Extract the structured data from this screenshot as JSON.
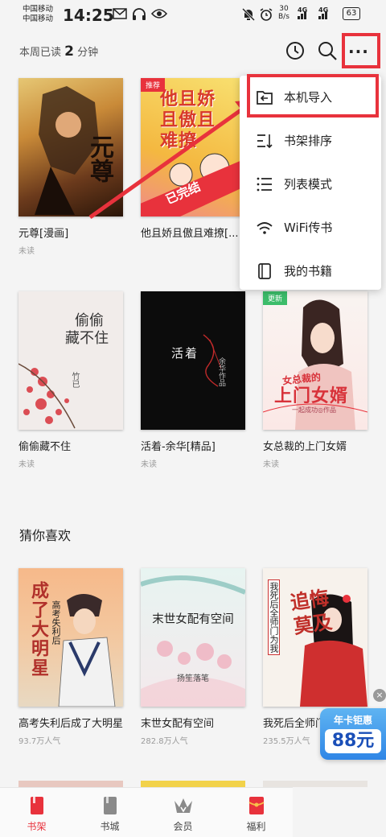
{
  "status_bar": {
    "carrier1": "中国移动",
    "carrier2": "中国移动",
    "time": "14:25",
    "speed_value": "30",
    "speed_unit": "B/s",
    "net1": "4G",
    "net2": "4G",
    "battery": "63"
  },
  "header": {
    "read_prefix": "本周已读",
    "read_value": "2",
    "read_unit": "分钟"
  },
  "menu": {
    "items": [
      {
        "label": "本机导入",
        "icon": "folder-import-icon"
      },
      {
        "label": "书架排序",
        "icon": "sort-icon"
      },
      {
        "label": "列表模式",
        "icon": "list-icon"
      },
      {
        "label": "WiFi传书",
        "icon": "wifi-icon"
      },
      {
        "label": "我的书籍",
        "icon": "book-icon"
      }
    ]
  },
  "shelf": [
    {
      "title": "元尊[漫画]",
      "status": "未读",
      "cover_text": "元尊"
    },
    {
      "title": "他且娇且傲且难撩[...",
      "status": "",
      "badge": "推荐",
      "cover_text": [
        "他且娇",
        "且傲且",
        "难撩"
      ],
      "ribbon": "已完结"
    },
    {
      "title": "偷偷藏不住",
      "status": "未读",
      "cover_text": [
        "偷偷",
        "藏不住"
      ],
      "cover_author": "竹已"
    },
    {
      "title": "活着-余华[精品]",
      "status": "未读",
      "cover_text": "活着",
      "cover_author": "余华作品"
    },
    {
      "title": "女总裁的上门女婿",
      "status": "未读",
      "badge": "更新",
      "cover_text": "上门女婿",
      "cover_top": "女总裁的",
      "cover_author": "一起成功◎作品"
    }
  ],
  "recommend": {
    "title": "猜你喜欢",
    "books": [
      {
        "title": "高考失利后成了大明星",
        "popularity": "93.7万人气",
        "cover_text": "成了大明星",
        "cover_side": "高考失利后"
      },
      {
        "title": "末世女配有空间",
        "popularity": "282.8万人气",
        "cover_text": "末世女配有空间",
        "cover_author": "扬笙落笔"
      },
      {
        "title": "我死后全师门为我...",
        "popularity": "235.5万人气",
        "cover_text": "追悔莫及",
        "cover_side": "我死后全师门为我"
      }
    ]
  },
  "promo": {
    "line1": "年卡钜惠",
    "line2": "88元"
  },
  "nav": [
    {
      "label": "书架",
      "icon": "bookshelf-icon",
      "active": true
    },
    {
      "label": "书城",
      "icon": "bookstore-icon",
      "active": false
    },
    {
      "label": "会员",
      "icon": "vip-crown-icon",
      "active": false
    },
    {
      "label": "福利",
      "icon": "gift-envelope-icon",
      "active": false
    }
  ],
  "colors": {
    "accent": "#e8323c",
    "highlight": "#e8323c"
  }
}
